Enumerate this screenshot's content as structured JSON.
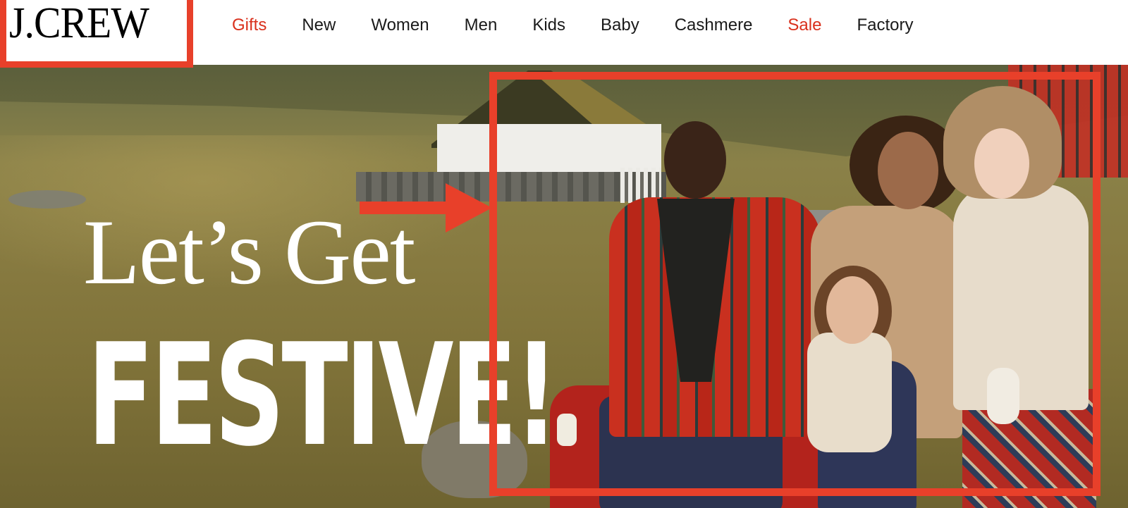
{
  "header": {
    "logo": "J.CREW",
    "nav": [
      {
        "label": "Gifts",
        "accent": true
      },
      {
        "label": "New",
        "accent": false
      },
      {
        "label": "Women",
        "accent": false
      },
      {
        "label": "Men",
        "accent": false
      },
      {
        "label": "Kids",
        "accent": false
      },
      {
        "label": "Baby",
        "accent": false
      },
      {
        "label": "Cashmere",
        "accent": false
      },
      {
        "label": "Sale",
        "accent": true
      },
      {
        "label": "Factory",
        "accent": false
      }
    ]
  },
  "hero": {
    "headline_line1": "Let’s Get",
    "headline_line2": "FESTIVE!"
  },
  "colors": {
    "annotation_red": "#e8402a",
    "nav_accent": "#d9301c",
    "nav_text": "#1a1a1a"
  },
  "icons": {
    "annotation_arrow": "arrow-right-icon"
  }
}
